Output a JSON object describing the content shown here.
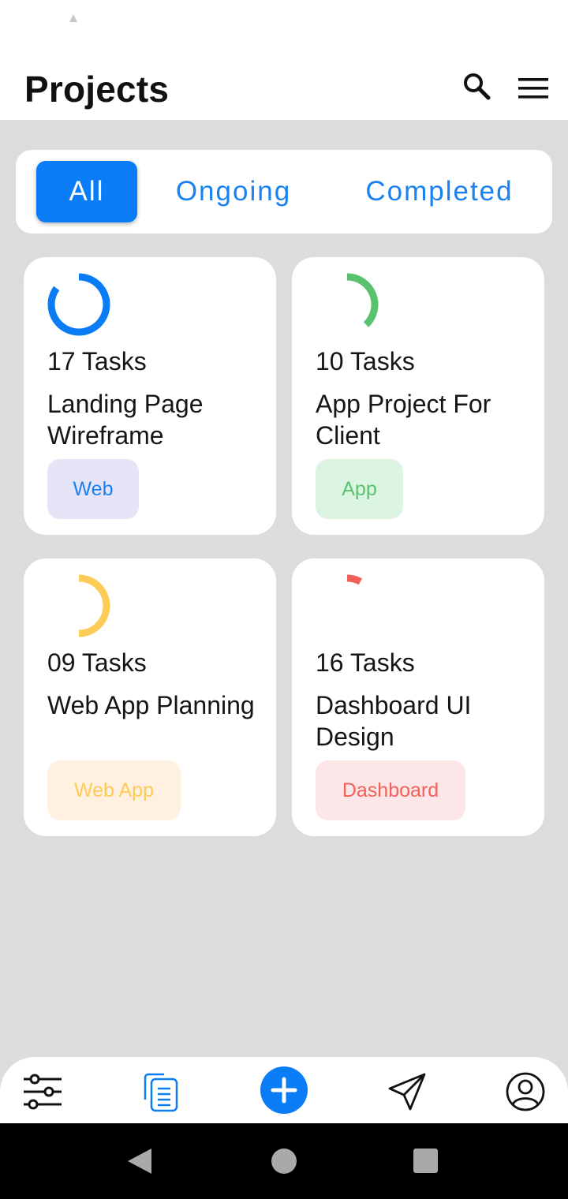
{
  "header": {
    "title": "Projects"
  },
  "tabs": [
    {
      "label": "All",
      "active": true
    },
    {
      "label": "Ongoing",
      "active": false
    },
    {
      "label": "Completed",
      "active": false
    }
  ],
  "projects": [
    {
      "tasks": "17 Tasks",
      "name": "Landing Page Wireframe",
      "tag": "Web",
      "progress": 0.85,
      "ring_color": "#0a7cf5",
      "tag_bg": "#e6e4f7",
      "tag_color": "#1a82f0"
    },
    {
      "tasks": "10 Tasks",
      "name": "App Project For Client",
      "tag": "App",
      "progress": 0.38,
      "ring_color": "#5ac26e",
      "tag_bg": "#dcf4e2",
      "tag_color": "#5ac26e"
    },
    {
      "tasks": "09 Tasks",
      "name": "Web App Planning",
      "tag": "Web App",
      "progress": 0.5,
      "ring_color": "#ffcb57",
      "tag_bg": "#fff1e2",
      "tag_color": "#ffcb57"
    },
    {
      "tasks": "16 Tasks",
      "name": "Dashboard UI Design",
      "tag": "Dashboard",
      "progress": 0.08,
      "ring_color": "#f2605a",
      "tag_bg": "#fde6e8",
      "tag_color": "#f2605a"
    }
  ],
  "bottom_nav": {
    "items": [
      {
        "icon": "sliders-icon"
      },
      {
        "icon": "documents-icon"
      },
      {
        "icon": "plus-icon"
      },
      {
        "icon": "send-icon"
      },
      {
        "icon": "profile-icon"
      }
    ]
  },
  "colors": {
    "accent": "#0a7cf5",
    "background": "#dcdcdf"
  }
}
